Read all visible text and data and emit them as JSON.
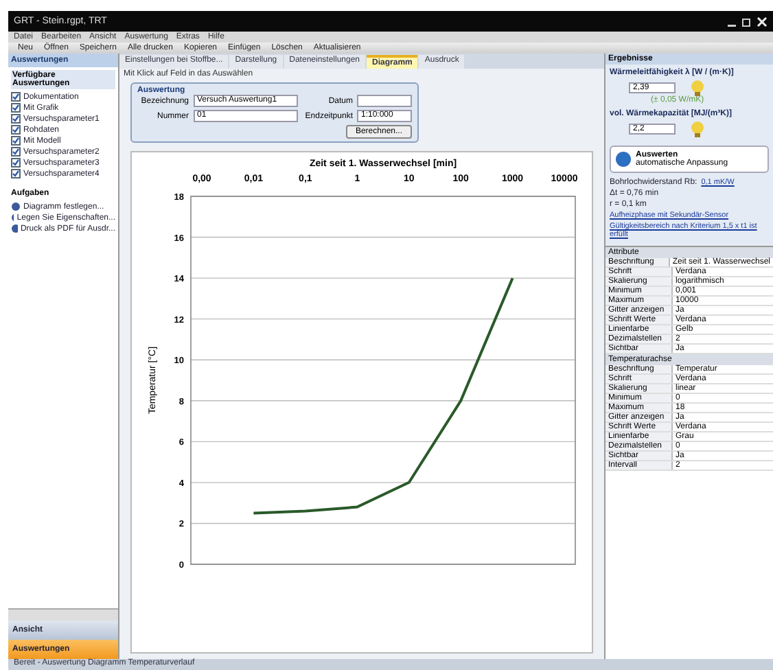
{
  "window": {
    "title": "GRT - Stein.rgpt, TRT"
  },
  "menu": [
    "Datei",
    "Bearbeiten",
    "Ansicht",
    "Auswertung",
    "Extras",
    "Hilfe"
  ],
  "toolbar": [
    "Neu",
    "Öffnen",
    "Speichern",
    "Alle drucken",
    "Kopieren",
    "Einfügen",
    "Löschen",
    "Aktualisieren"
  ],
  "left_panel": {
    "header": "Auswertungen",
    "section": "Verfügbare Auswertungen",
    "items": [
      {
        "label": "Dokumentation",
        "checked": true
      },
      {
        "label": "Mit Grafik",
        "checked": true
      },
      {
        "label": "Versuchsparameter1",
        "checked": true
      },
      {
        "label": "Rohdaten",
        "checked": true
      },
      {
        "label": "Mit Modell",
        "checked": true
      },
      {
        "label": "Versuchsparameter2",
        "checked": true
      },
      {
        "label": "Versuchsparameter3",
        "checked": true
      },
      {
        "label": "Versuchsparameter4",
        "checked": true
      }
    ],
    "tasks_title": "Aufgaben",
    "tasks": [
      "Diagramm festlegen...",
      "Legen Sie Eigenschaften...",
      "Druck als PDF für Ausdr..."
    ],
    "nav": [
      {
        "label": "Ansicht",
        "selected": false
      },
      {
        "label": "Auswertungen",
        "selected": true
      }
    ]
  },
  "doc_tabs": [
    {
      "label": "Einstellungen bei Stoffbe...",
      "selected": false
    },
    {
      "label": "Darstellung",
      "selected": false
    },
    {
      "label": "Dateneinstellungen",
      "selected": false
    },
    {
      "label": "Diagramm",
      "selected": true
    },
    {
      "label": "Ausdruck",
      "selected": false
    }
  ],
  "hint": "Mit Klick auf Feld in das Auswählen",
  "form": {
    "title": "Auswertung",
    "fields": [
      {
        "label": "Bezeichnung",
        "value": "Versuch Auswertung1"
      },
      {
        "label": "Datum"
      },
      {
        "label": "Nummer",
        "value": "01"
      },
      {
        "label": "Endzeitpunkt",
        "value": "1:10:000"
      }
    ],
    "button": "Berechnen..."
  },
  "chart": {
    "chart_data": {
      "type": "line",
      "title": "Zeit seit 1. Wasserwechsel [min]",
      "ylabel": "Temperatur [°C]",
      "categories": [
        "0,00",
        "0,01",
        "0,1",
        "1",
        "10",
        "100",
        "1000",
        "10000"
      ],
      "series": [
        {
          "color": "#2a5a2a",
          "values": [
            null,
            2.5,
            2.6,
            2.8,
            4.0,
            8.0,
            14.0,
            null
          ]
        }
      ],
      "ylim": [
        0,
        18
      ],
      "grid": true,
      "yticks": [
        0,
        2,
        4,
        6,
        8,
        10,
        12,
        14,
        16,
        18
      ]
    }
  },
  "results": {
    "title": "Ergebnisse",
    "params": [
      {
        "label": "Wärmeleitfähigkeit λ [W / (m·K)]",
        "value": "2,39",
        "note": "(± 0,05 W/mK)"
      },
      {
        "label": "vol. Wärmekapazität [MJ/(m³K)]",
        "value": "2,2"
      }
    ],
    "info_title": "Auswerten",
    "info_sub": "automatische Anpassung",
    "lines": [
      {
        "text": "Bohrlochwiderstand Rb:",
        "link": "0,1 mK/W"
      },
      {
        "text": "Δt = 0,76 min"
      },
      {
        "text": "r = 0,1 km"
      },
      {
        "link": "Aufheizphase mit Sekundär-Sensor"
      },
      {
        "link": "Gültigkeitsbereich nach Kriterium 1,5 x t1 ist erfüllt"
      }
    ]
  },
  "properties": {
    "title": "Attribute",
    "groups": [
      {
        "rows": [
          {
            "key": "Beschriftung",
            "value": "Zeit seit 1. Wasserwechsel"
          },
          {
            "key": "Schrift",
            "value": "Verdana"
          },
          {
            "key": "Skalierung",
            "value": "logarithmisch"
          },
          {
            "key": "Minimum",
            "value": "0,001"
          },
          {
            "key": "Maximum",
            "value": "10000"
          },
          {
            "key": "Gitter anzeigen",
            "value": "Ja"
          },
          {
            "key": "Schrift Werte",
            "value": "Verdana"
          },
          {
            "key": "Linienfarbe",
            "value": "Gelb"
          },
          {
            "key": "Dezimalstellen",
            "value": "2"
          },
          {
            "key": "Sichtbar",
            "value": "Ja"
          }
        ]
      },
      {
        "title": "Temperaturachse",
        "rows": [
          {
            "key": "Beschriftung",
            "value": "Temperatur"
          },
          {
            "key": "Schrift",
            "value": "Verdana"
          },
          {
            "key": "Skalierung",
            "value": "linear"
          },
          {
            "key": "Minimum",
            "value": "0"
          },
          {
            "key": "Maximum",
            "value": "18"
          },
          {
            "key": "Gitter anzeigen",
            "value": "Ja"
          },
          {
            "key": "Schrift Werte",
            "value": "Verdana"
          },
          {
            "key": "Linienfarbe",
            "value": "Grau"
          },
          {
            "key": "Dezimalstellen",
            "value": "0"
          },
          {
            "key": "Sichtbar",
            "value": "Ja"
          },
          {
            "key": "Intervall",
            "value": "2"
          }
        ]
      }
    ]
  },
  "status_bar": "Bereit - Auswertung Diagramm Temperaturverlauf"
}
